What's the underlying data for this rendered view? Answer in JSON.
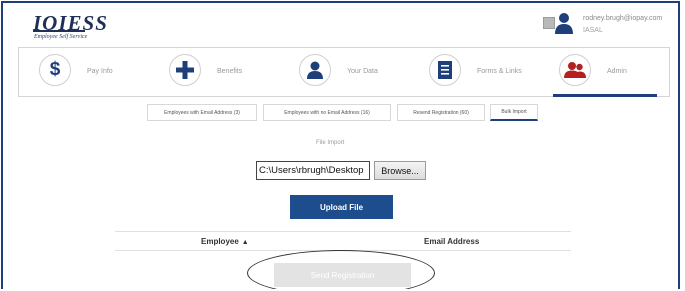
{
  "header": {
    "logo_title": "IOIESS",
    "logo_subtitle": "Employee Self Service",
    "user_email": "rodney.brugh@iopay.com",
    "user_org": "IASAL"
  },
  "nav": {
    "items": [
      {
        "label": "Pay Info",
        "icon": "dollar-icon"
      },
      {
        "label": "Benefits",
        "icon": "plus-icon"
      },
      {
        "label": "Your Data",
        "icon": "person-icon"
      },
      {
        "label": "Forms & Links",
        "icon": "document-icon"
      },
      {
        "label": "Admin",
        "icon": "group-icon"
      }
    ],
    "active": "Admin"
  },
  "subtabs": [
    {
      "label": "Employees with Email Address (3)"
    },
    {
      "label": "Employees with no Email Address (16)"
    },
    {
      "label": "Resend Registration (60)"
    },
    {
      "label": "Bulk Import"
    }
  ],
  "active_subtab": "Bulk Import",
  "import": {
    "section_label": "File Import",
    "file_path": "C:\\Users\\rbrugh\\Desktop",
    "browse_label": "Browse...",
    "upload_label": "Upload File"
  },
  "table": {
    "columns": [
      "Employee",
      "Email Address"
    ],
    "sort_column": "Employee",
    "sort_indicator": "▲"
  },
  "send_label": "Send Registration",
  "colors": {
    "brand": "#1f3f7a",
    "upload_button": "#1d4d8c",
    "admin_icon": "#b32020",
    "disabled_button": "#e3e3e3"
  }
}
